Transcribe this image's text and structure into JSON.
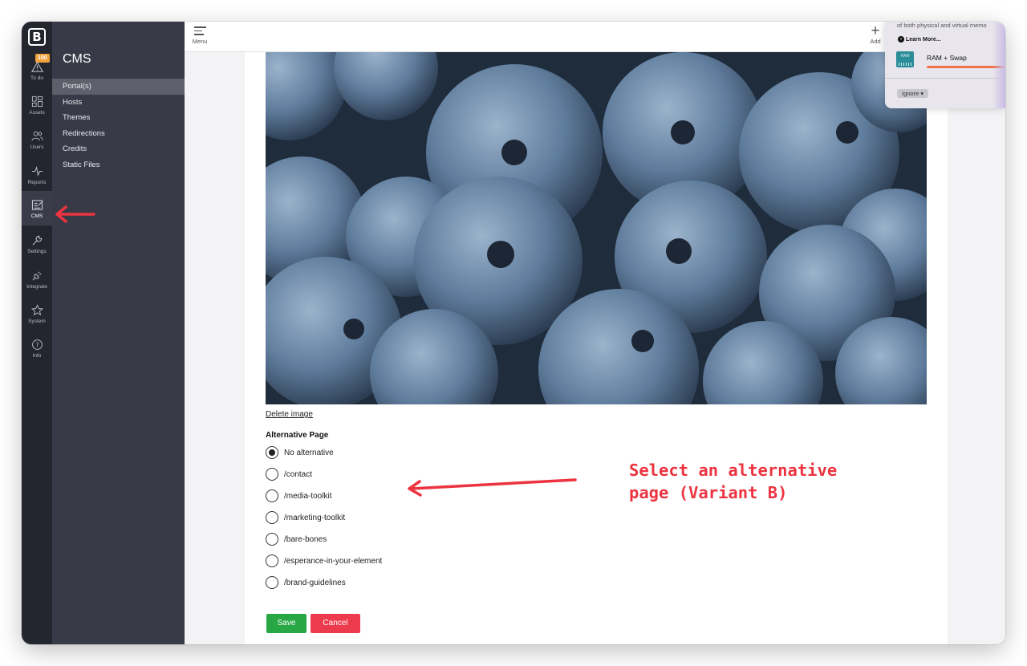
{
  "rail": {
    "badge": "100",
    "items": [
      {
        "label": "To do",
        "icon": "alert-icon"
      },
      {
        "label": "Assets",
        "icon": "assets-icon"
      },
      {
        "label": "Users",
        "icon": "users-icon"
      },
      {
        "label": "Reports",
        "icon": "pulse-icon"
      },
      {
        "label": "CMS",
        "icon": "cms-icon"
      },
      {
        "label": "Settings",
        "icon": "wrench-icon"
      },
      {
        "label": "Integrate",
        "icon": "plug-icon"
      },
      {
        "label": "System",
        "icon": "star-icon"
      },
      {
        "label": "Info",
        "icon": "info-icon"
      }
    ]
  },
  "sidebar": {
    "title": "CMS",
    "items": [
      {
        "label": "Portal(s)"
      },
      {
        "label": "Hosts"
      },
      {
        "label": "Themes"
      },
      {
        "label": "Redirections"
      },
      {
        "label": "Credits"
      },
      {
        "label": "Static Files"
      }
    ]
  },
  "topbar": {
    "menu_label": "Menu",
    "add_label": "Add"
  },
  "content": {
    "delete_image": "Delete image",
    "alt_page_title": "Alternative Page",
    "options": [
      {
        "label": "No alternative",
        "checked": true
      },
      {
        "label": "/contact",
        "checked": false
      },
      {
        "label": "/media-toolkit",
        "checked": false
      },
      {
        "label": "/marketing-toolkit",
        "checked": false
      },
      {
        "label": "/bare-bones",
        "checked": false
      },
      {
        "label": "/esperance-in-your-element",
        "checked": false
      },
      {
        "label": "/brand-guidelines",
        "checked": false
      }
    ],
    "save_label": "Save",
    "cancel_label": "Cancel"
  },
  "annotation": {
    "line1": "Select an alternative",
    "line2": "page (Variant B)"
  },
  "popup": {
    "description": "of both physical and virtual memo",
    "learn_more": "Learn More...",
    "ram_icon_text": "RAM",
    "ram_label": "RAM + Swap",
    "ignore": "Ignore"
  },
  "colors": {
    "rail_bg": "#24262f",
    "sidebar_bg": "#383b47",
    "save": "#28a745",
    "cancel": "#ec3b4d",
    "annotation": "#ec3440"
  }
}
